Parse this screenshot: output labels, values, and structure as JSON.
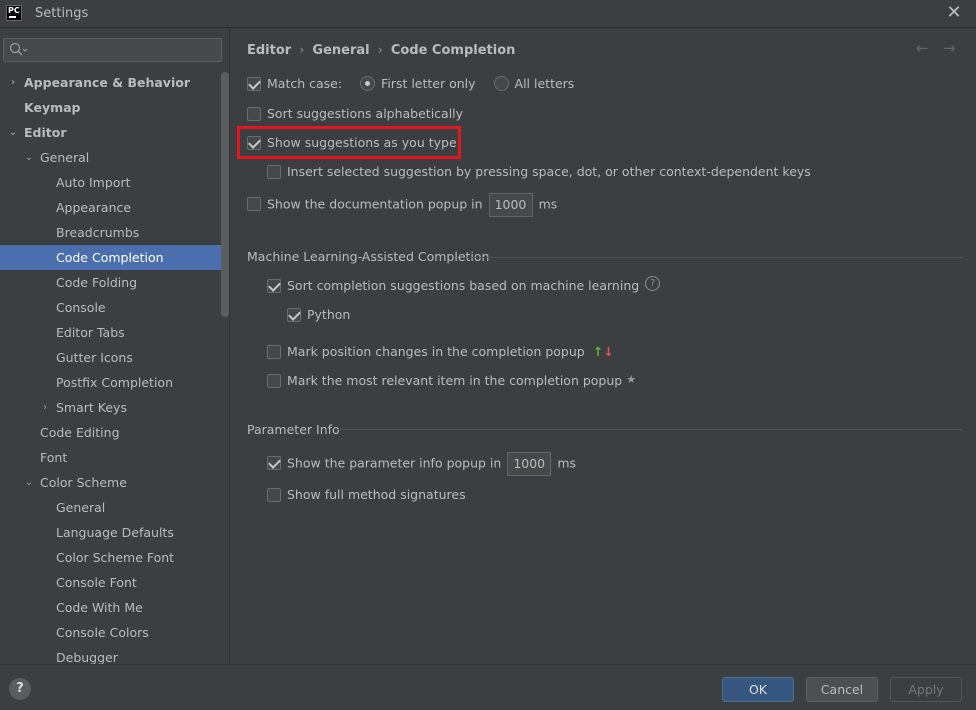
{
  "window": {
    "title": "Settings",
    "logo": "PC"
  },
  "sidebar": {
    "items": [
      {
        "label": "Appearance & Behavior",
        "arrow": "›"
      },
      {
        "label": "Keymap"
      },
      {
        "label": "Editor",
        "arrow": "⌄"
      },
      {
        "label": "General",
        "arrow": "⌄"
      },
      {
        "label": "Auto Import"
      },
      {
        "label": "Appearance"
      },
      {
        "label": "Breadcrumbs"
      },
      {
        "label": "Code Completion"
      },
      {
        "label": "Code Folding"
      },
      {
        "label": "Console"
      },
      {
        "label": "Editor Tabs"
      },
      {
        "label": "Gutter Icons"
      },
      {
        "label": "Postfix Completion"
      },
      {
        "label": "Smart Keys",
        "arrow": "›"
      },
      {
        "label": "Code Editing"
      },
      {
        "label": "Font"
      },
      {
        "label": "Color Scheme",
        "arrow": "⌄"
      },
      {
        "label": "General"
      },
      {
        "label": "Language Defaults"
      },
      {
        "label": "Color Scheme Font"
      },
      {
        "label": "Console Font"
      },
      {
        "label": "Code With Me"
      },
      {
        "label": "Console Colors"
      },
      {
        "label": "Debugger"
      }
    ]
  },
  "breadcrumb": {
    "part1": "Editor",
    "part2": "General",
    "part3": "Code Completion",
    "sep": "›"
  },
  "nav": {
    "back": "←",
    "forward": "→"
  },
  "options": {
    "match_case": "Match case:",
    "first_letter_only": "First letter only",
    "all_letters": "All letters",
    "sort_alpha": "Sort suggestions alphabetically",
    "show_as_type": "Show suggestions as you type",
    "insert_selected": "Insert selected suggestion by pressing space, dot, or other context-dependent keys",
    "show_doc_popup": "Show the documentation popup in",
    "doc_popup_value": "1000",
    "ms": "ms"
  },
  "ml": {
    "title": "Machine Learning-Assisted Completion",
    "sort_ml": "Sort completion suggestions based on machine learning",
    "help": "?",
    "python": "Python",
    "mark_position": "Mark position changes in the completion popup",
    "up": "↑",
    "down": "↓",
    "mark_relevant": "Mark the most relevant item in the completion popup",
    "star": "★"
  },
  "param": {
    "title": "Parameter Info",
    "show_param_popup": "Show the parameter info popup in",
    "param_popup_value": "1000",
    "ms": "ms",
    "full_signatures": "Show full method signatures"
  },
  "footer": {
    "help": "?",
    "ok": "OK",
    "cancel": "Cancel",
    "apply": "Apply"
  },
  "colors": {
    "selection": "#4b6eaf",
    "highlight": "#e3161f",
    "primary": "#365880"
  }
}
